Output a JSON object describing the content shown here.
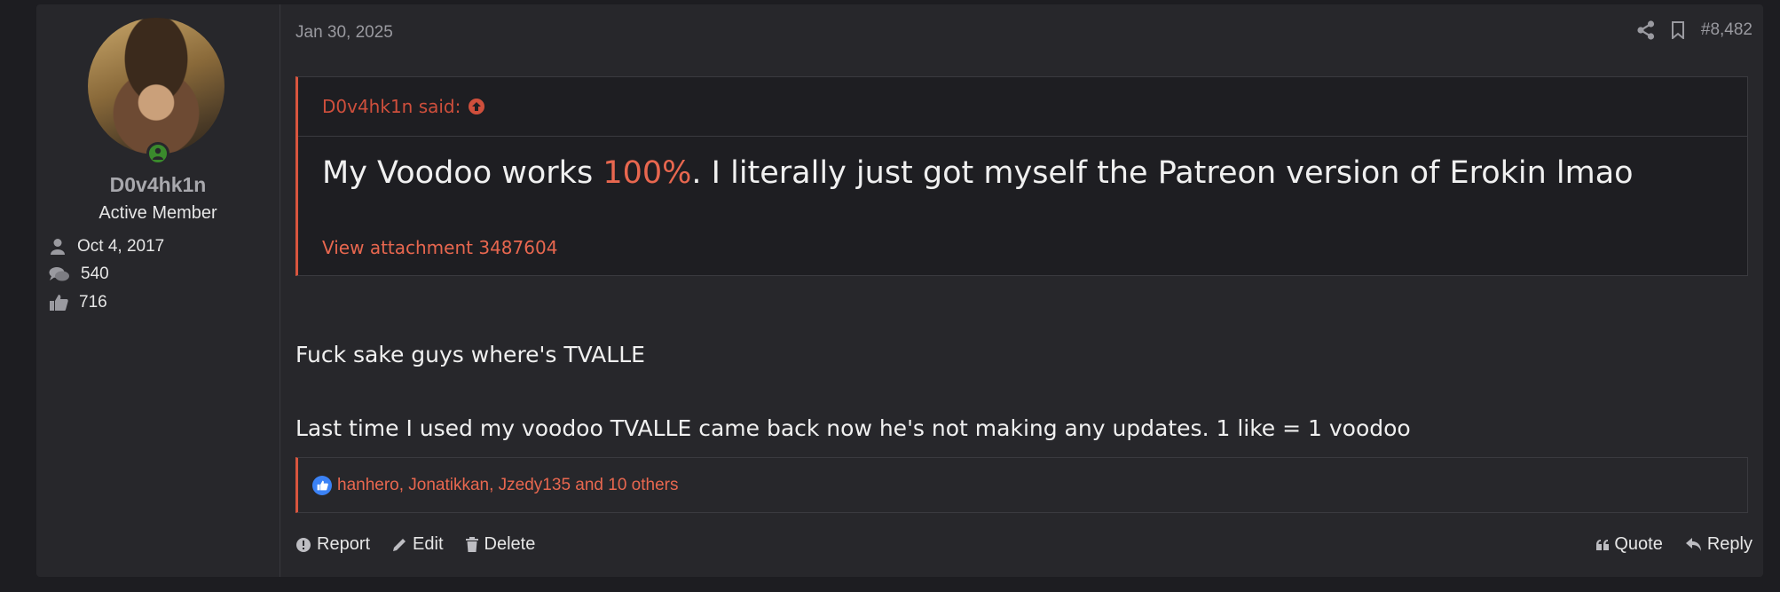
{
  "user": {
    "username": "D0v4hk1n",
    "title": "Active Member",
    "joined": "Oct 4, 2017",
    "messages": "540",
    "reactions": "716"
  },
  "post": {
    "date": "Jan 30, 2025",
    "number": "#8,482",
    "quote": {
      "author_said": "D0v4hk1n said:",
      "text_before": "My Voodoo works ",
      "text_highlight": "100%",
      "text_after": ". I literally just got myself the Patreon version of Erokin lmao",
      "attachment": "View attachment 3487604"
    },
    "body": [
      "Fuck sake guys where's TVALLE",
      "Last time I used my voodoo TVALLE came back now he's not making any updates. 1 like = 1 voodoo"
    ],
    "reactions_text": "hanhero, Jonatikkan, Jzedy135 and 10 others"
  },
  "actions": {
    "report": "Report",
    "edit": "Edit",
    "delete": "Delete",
    "quote": "Quote",
    "reply": "Reply"
  },
  "colors": {
    "accent": "#d9553e",
    "link": "#e8674f",
    "online": "#3a8a2c",
    "like_badge": "#3b82f6"
  },
  "icons": [
    "share-icon",
    "bookmark-icon",
    "arrow-up-circle-icon",
    "user-icon",
    "comments-icon",
    "thumbs-up-icon",
    "report-icon",
    "pencil-icon",
    "trash-icon",
    "quote-icon",
    "reply-icon"
  ]
}
